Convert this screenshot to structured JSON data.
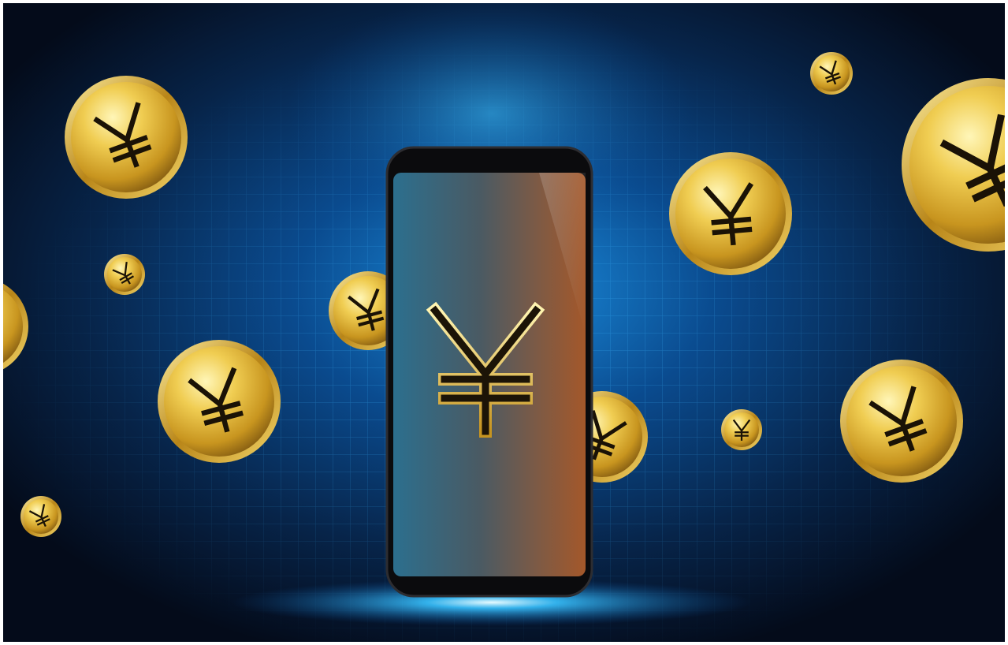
{
  "illustration": {
    "subject": "smartphone-with-yen-symbol",
    "icon": "yen-icon",
    "colors": {
      "background_dark": "#061023",
      "glow_blue": "#1fa9ff",
      "grid_line": "#3fb8ff",
      "coin_gold_light": "#fff3a6",
      "coin_gold_mid": "#e3b93c",
      "coin_gold_dark": "#8a6212",
      "phone_frame": "#0c0c0e",
      "screen_blue": "#2f6f88",
      "screen_brown": "#9a5a2e"
    }
  }
}
